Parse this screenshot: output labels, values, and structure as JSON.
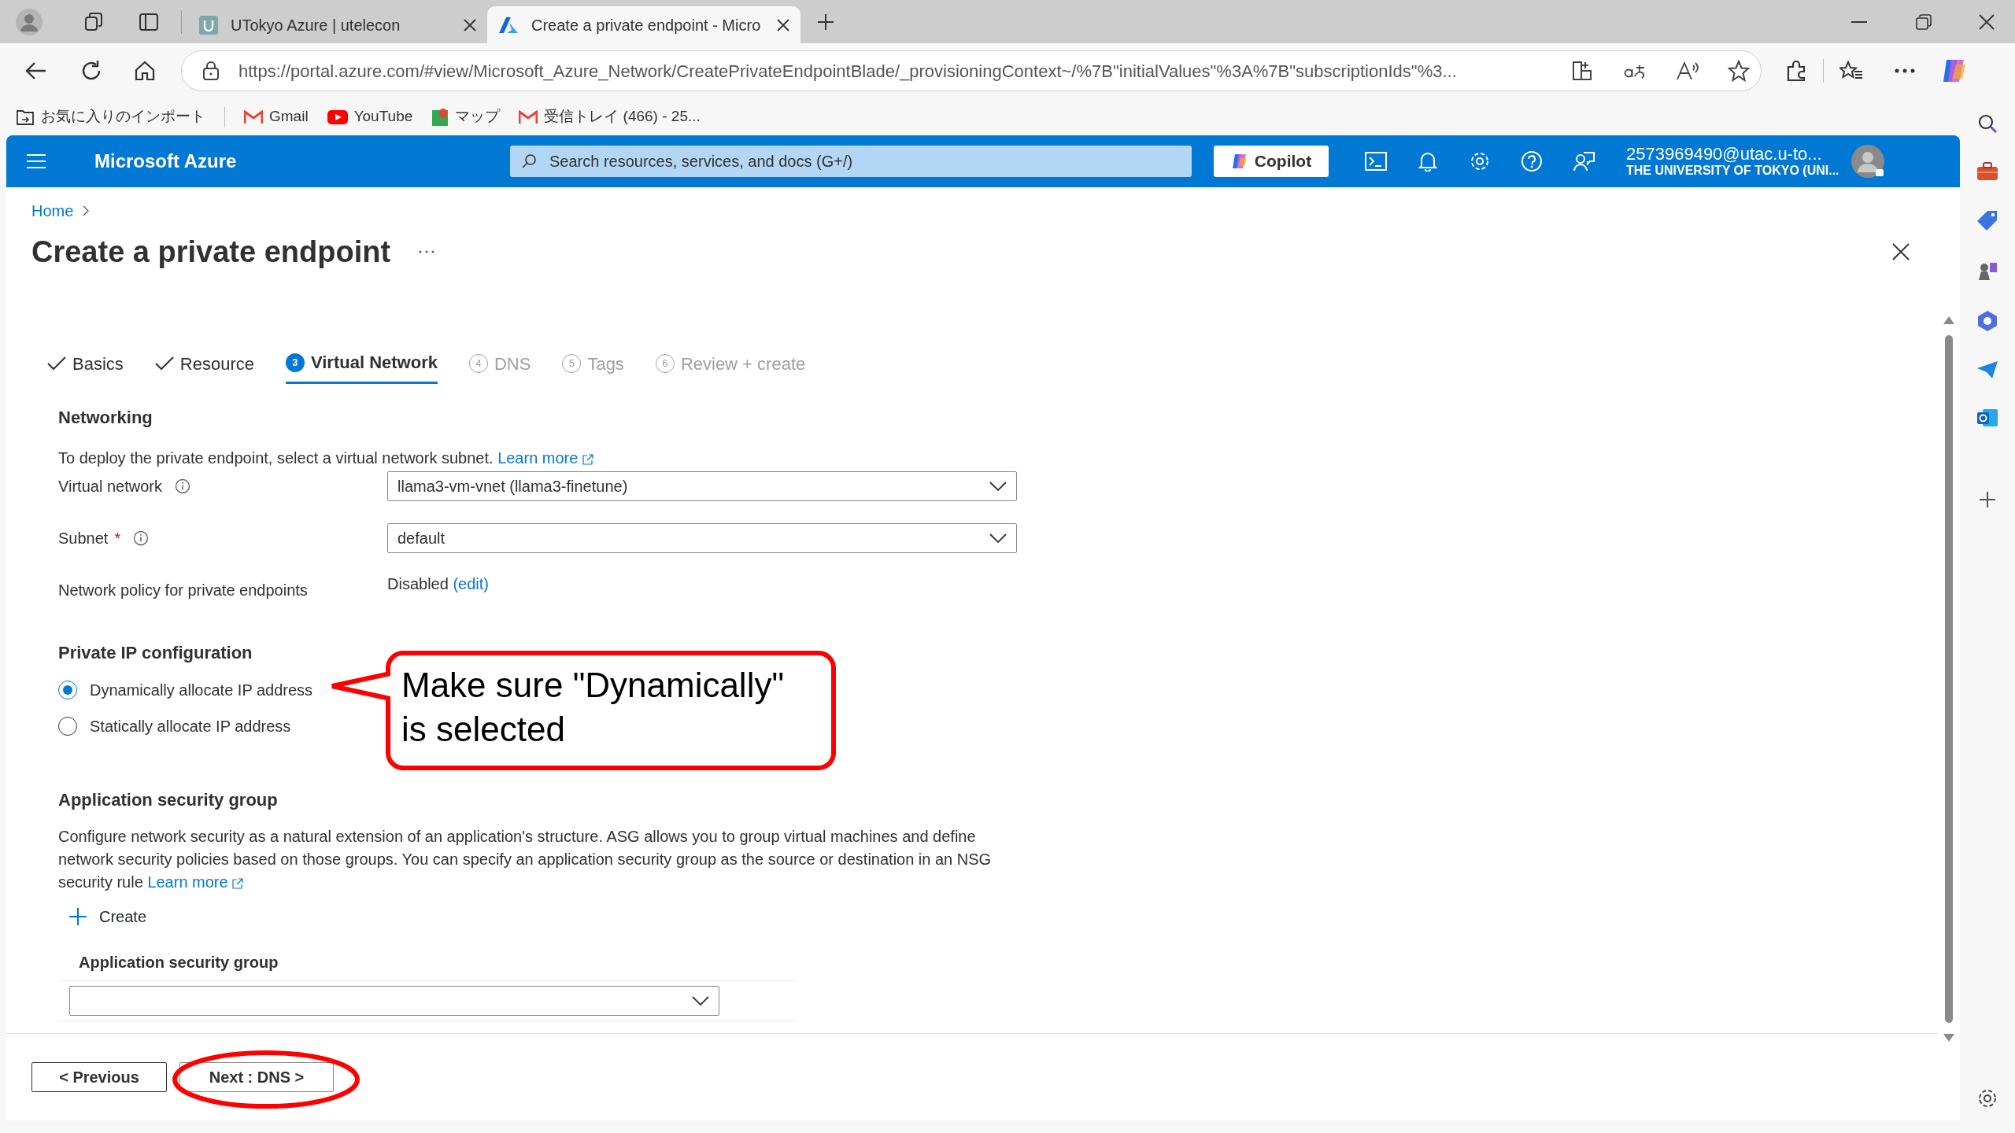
{
  "browser": {
    "tabs": [
      {
        "title": "UTokyo Azure | utelecon",
        "selected": false
      },
      {
        "title": "Create a private endpoint - Micro",
        "selected": true
      }
    ],
    "address": "https://portal.azure.com/#view/Microsoft_Azure_Network/CreatePrivateEndpointBlade/_provisioningContext~/%7B\"initialValues\"%3A%7B\"subscriptionIds\"%3...",
    "bookmarks": [
      "お気に入りのインポート",
      "Gmail",
      "YouTube",
      "マップ",
      "受信トレイ (466) - 25..."
    ]
  },
  "header": {
    "brand": "Microsoft Azure",
    "search_placeholder": "Search resources, services, and docs (G+/)",
    "copilot": "Copilot",
    "account_name": "2573969490@utac.u-to...",
    "account_org": "THE UNIVERSITY OF TOKYO (UNI..."
  },
  "breadcrumb": [
    "Home"
  ],
  "title": "Create a private endpoint",
  "wizard_tabs": [
    {
      "label": "Basics",
      "kind": "done",
      "selected": false
    },
    {
      "label": "Resource",
      "kind": "done",
      "selected": false
    },
    {
      "label": "Virtual Network",
      "number": "3",
      "kind": "step",
      "selected": true
    },
    {
      "label": "DNS",
      "number": "4",
      "kind": "step",
      "selected": false
    },
    {
      "label": "Tags",
      "number": "5",
      "kind": "step",
      "selected": false
    },
    {
      "label": "Review + create",
      "number": "6",
      "kind": "step",
      "selected": false
    }
  ],
  "networking": {
    "heading": "Networking",
    "intro": "To deploy the private endpoint, select a virtual network subnet.",
    "learn_more": "Learn more",
    "virtual_network": {
      "label": "Virtual network",
      "value": "llama3-vm-vnet (llama3-finetune)"
    },
    "subnet": {
      "label": "Subnet",
      "required_mark": "*",
      "value": "default"
    },
    "policy": {
      "label": "Network policy for private endpoints",
      "value": "Disabled",
      "edit": "(edit)"
    }
  },
  "private_ip": {
    "heading": "Private IP configuration",
    "options": [
      {
        "label": "Dynamically allocate IP address",
        "selected": true
      },
      {
        "label": "Statically allocate IP address",
        "selected": false
      }
    ]
  },
  "asg": {
    "heading": "Application security group",
    "description": "Configure network security as a natural extension of an application's structure. ASG allows you to group virtual machines and define network security policies based on those groups. You can specify an application security group as the source or destination in an NSG security rule",
    "learn_more": "Learn more",
    "create": "Create",
    "column": "Application security group"
  },
  "footer": {
    "previous": "< Previous",
    "next": "Next : DNS >"
  },
  "annotations": [
    {
      "kind": "callout",
      "text": "Make sure \"Dynamically\"\nis selected"
    },
    {
      "kind": "ellipse"
    }
  ]
}
